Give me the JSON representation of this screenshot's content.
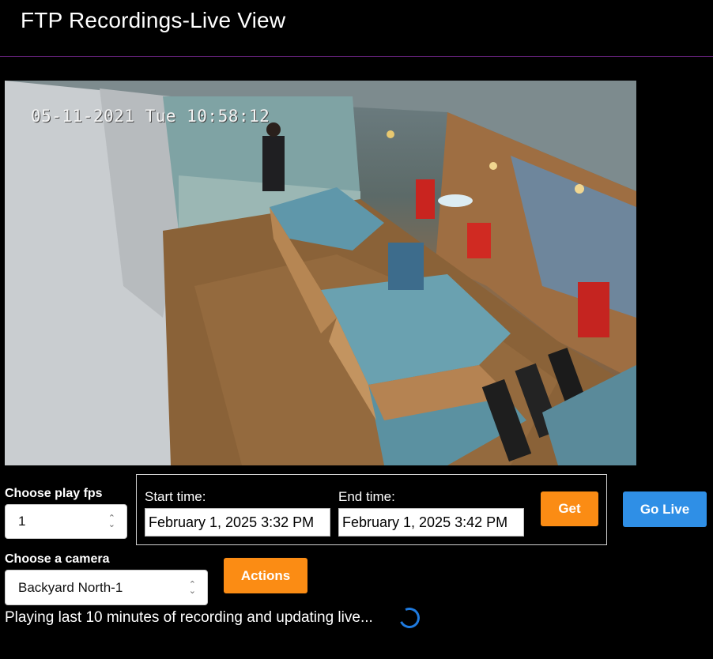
{
  "header": {
    "title": "FTP Recordings-Live View"
  },
  "video": {
    "timestamp": "05-11-2021 Tue 10:58:12"
  },
  "fps": {
    "label": "Choose play fps",
    "value": "1"
  },
  "time_range": {
    "start_label": "Start time:",
    "start_value": "February 1, 2025 3:32 PM",
    "end_label": "End time:",
    "end_value": "February 1, 2025 3:42 PM",
    "get_label": "Get"
  },
  "go_live_label": "Go Live",
  "camera": {
    "label": "Choose a camera",
    "value": "Backyard North-1"
  },
  "actions_label": "Actions",
  "status": {
    "text": "Playing last 10 minutes of recording and updating live..."
  },
  "colors": {
    "orange": "#fb8c14",
    "blue": "#2f8fe6",
    "spinner": "#1f7be0",
    "border_purple": "#5a1e6e"
  }
}
